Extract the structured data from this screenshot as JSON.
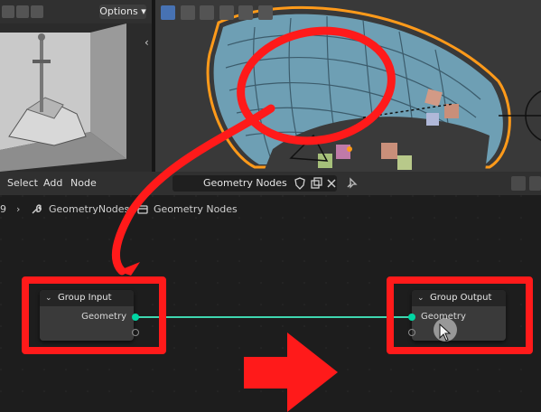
{
  "image_editor": {
    "options_label": "Options",
    "chevron_left": "‹",
    "chevron_right": "›"
  },
  "node_editor": {
    "menu": [
      "Select",
      "Add",
      "Node"
    ],
    "node_tree_name": "Geometry Nodes",
    "breadcrumb": {
      "prefix": "9",
      "modifier": "GeometryNodes",
      "tree": "Geometry Nodes"
    },
    "nodes": {
      "group_input": {
        "title": "Group Input",
        "socket": "Geometry"
      },
      "group_output": {
        "title": "Group Output",
        "socket": "Geometry"
      }
    }
  },
  "colors": {
    "annotation_red": "#ff1a1a",
    "geometry_socket": "#00d6a3",
    "link": "#3fd6b0",
    "mesh": "#6e9fb4",
    "selection_outline": "#ff9a1a"
  },
  "icons": [
    "arrow-icon",
    "wrench-icon",
    "node-tree-icon",
    "shield-icon",
    "copy-icon",
    "close-icon",
    "pin-icon"
  ]
}
